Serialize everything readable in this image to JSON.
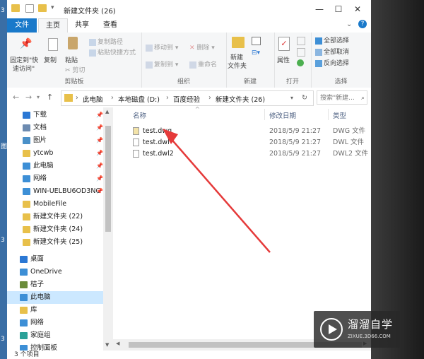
{
  "window": {
    "title": "新建文件夹 (26)",
    "controls": {
      "minimize": "—",
      "maximize": "☐",
      "close": "✕",
      "chevron": "⌄",
      "help": "?"
    }
  },
  "left_strip": [
    "3",
    "图",
    "3",
    "3"
  ],
  "tabs": {
    "file": "文件",
    "home": "主页",
    "share": "共享",
    "view": "查看"
  },
  "ribbon": {
    "clipboard": {
      "pin_line1": "固定到\"快",
      "pin_line2": "速访问\"",
      "copy": "复制",
      "paste": "粘贴",
      "copy_path": "复制路径",
      "paste_shortcut": "粘贴快捷方式",
      "cut": "剪切",
      "label": "剪贴板"
    },
    "organize": {
      "move_to": "移动到",
      "copy_to": "复制到",
      "delete": "删除",
      "rename": "重命名",
      "label": "组织"
    },
    "new": {
      "new_folder_line1": "新建",
      "new_folder_line2": "文件夹",
      "label": "新建"
    },
    "open": {
      "properties": "属性",
      "label": "打开"
    },
    "select": {
      "select_all": "全部选择",
      "select_none": "全部取消",
      "invert": "反向选择",
      "label": "选择"
    }
  },
  "address": {
    "back": "←",
    "forward": "→",
    "up": "↑",
    "crumbs": [
      "此电脑",
      "本地磁盘 (D:)",
      "百度经验",
      "新建文件夹 (26)"
    ],
    "search_placeholder": "搜索\"新建..."
  },
  "nav": [
    {
      "label": "下载",
      "color": "#2b78d4",
      "pinned": true
    },
    {
      "label": "文档",
      "color": "#6d8bb0",
      "pinned": true
    },
    {
      "label": "图片",
      "color": "#4a90c8",
      "pinned": true
    },
    {
      "label": "ytcwb",
      "color": "#e8c04a",
      "pinned": true
    },
    {
      "label": "此电脑",
      "color": "#3d8fd6",
      "pinned": true
    },
    {
      "label": "网络",
      "color": "#3d8fd6",
      "pinned": true
    },
    {
      "label": "WIN-UELBU6OD3NC",
      "color": "#3d8fd6",
      "pinned": true
    },
    {
      "label": "MobileFile",
      "color": "#e8c04a",
      "pinned": false
    },
    {
      "label": "新建文件夹 (22)",
      "color": "#e8c04a",
      "pinned": false
    },
    {
      "label": "新建文件夹 (24)",
      "color": "#e8c04a",
      "pinned": false
    },
    {
      "label": "新建文件夹 (25)",
      "color": "#e8c04a",
      "pinned": false
    },
    {
      "label": "桌面",
      "color": "#2b78d4",
      "pinned": false
    },
    {
      "label": "OneDrive",
      "color": "#3d8fd6",
      "pinned": false
    },
    {
      "label": "桔子",
      "color": "#6a8c3a",
      "pinned": false
    },
    {
      "label": "此电脑",
      "color": "#3d8fd6",
      "pinned": false,
      "selected": true
    },
    {
      "label": "库",
      "color": "#e8c04a",
      "pinned": false
    },
    {
      "label": "网络",
      "color": "#3d8fd6",
      "pinned": false
    },
    {
      "label": "家庭组",
      "color": "#2aa198",
      "pinned": false
    },
    {
      "label": "控制面板",
      "color": "#3d8fd6",
      "pinned": false
    }
  ],
  "columns": {
    "name": "名称",
    "date": "修改日期",
    "type": "类型"
  },
  "files": [
    {
      "name": "test.dwg",
      "date": "2018/5/9 21:27",
      "type": "DWG 文件"
    },
    {
      "name": "test.dwl",
      "date": "2018/5/9 21:27",
      "type": "DWL 文件"
    },
    {
      "name": "test.dwl2",
      "date": "2018/5/9 21:27",
      "type": "DWL2 文件"
    }
  ],
  "status": {
    "count": "3 个项目"
  },
  "watermark": {
    "brand": "溜溜自学",
    "site": "ZIXUE.3D66.COM"
  },
  "colors": {
    "accent": "#1979ca",
    "arrow": "#e53a3a",
    "selected": "#cce8ff"
  }
}
